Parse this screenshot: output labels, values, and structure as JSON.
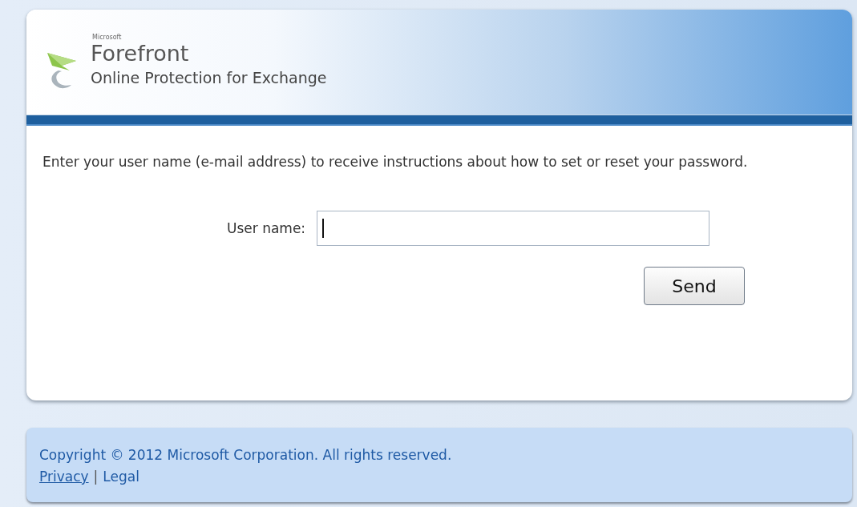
{
  "header": {
    "brand_small": "Microsoft",
    "product": "Forefront",
    "subtitle": "Online Protection for Exchange"
  },
  "instructions": "Enter your user name (e-mail address) to receive instructions about how to set or reset your password.",
  "form": {
    "label": "User name:",
    "focused": true,
    "button": "Send"
  },
  "footer": {
    "copyright": "Copyright © 2012 Microsoft Corporation. All rights reserved.",
    "links": [
      "Privacy",
      "Legal"
    ],
    "separator": "|"
  }
}
